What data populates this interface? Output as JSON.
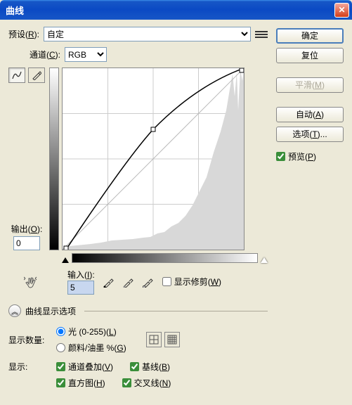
{
  "window": {
    "title": "曲线"
  },
  "preset": {
    "label": "预设(",
    "hotkey": "R",
    "close": "):",
    "value": "自定"
  },
  "channel": {
    "label": "通道(",
    "hotkey": "C",
    "close": "):",
    "value": "RGB"
  },
  "output": {
    "label": "输出(",
    "hotkey": "O",
    "close": "):",
    "value": "0"
  },
  "input": {
    "label": "输入(",
    "hotkey": "I",
    "close": "):",
    "value": "5"
  },
  "show_clipping": {
    "label": "显示修剪(",
    "hotkey": "W",
    "close": ")"
  },
  "options_title": "曲线显示选项",
  "display_amount": {
    "label": "显示数量:",
    "light": "光 (0-255)(",
    "light_hk": "L",
    "pigment": "颜料/油墨 %(",
    "pigment_hk": "G",
    "close": ")"
  },
  "display": {
    "label": "显示:",
    "overlay": "通道叠加(",
    "overlay_hk": "V",
    "baseline": "基线(",
    "baseline_hk": "B",
    "histogram": "直方图(",
    "histogram_hk": "H",
    "intersection": "交叉线(",
    "intersection_hk": "N",
    "close": ")"
  },
  "buttons": {
    "ok": "确定",
    "reset": "复位",
    "smooth": "平滑(",
    "smooth_hk": "M",
    "auto": "自动(",
    "auto_hk": "A",
    "options": "选项(",
    "options_hk": "T",
    "options_suffix": ")...",
    "close": ")"
  },
  "preview": {
    "label": "预览(",
    "hotkey": "P",
    "close": ")"
  },
  "chart_data": {
    "type": "curves",
    "xrange": [
      0,
      255
    ],
    "yrange": [
      0,
      255
    ],
    "curve_points": [
      [
        5,
        0
      ],
      [
        128,
        170
      ],
      [
        255,
        255
      ]
    ],
    "grid": "4x4",
    "histogram_shape": "right-skewed with tall spike near 245-255 and low spread across 0-200"
  }
}
